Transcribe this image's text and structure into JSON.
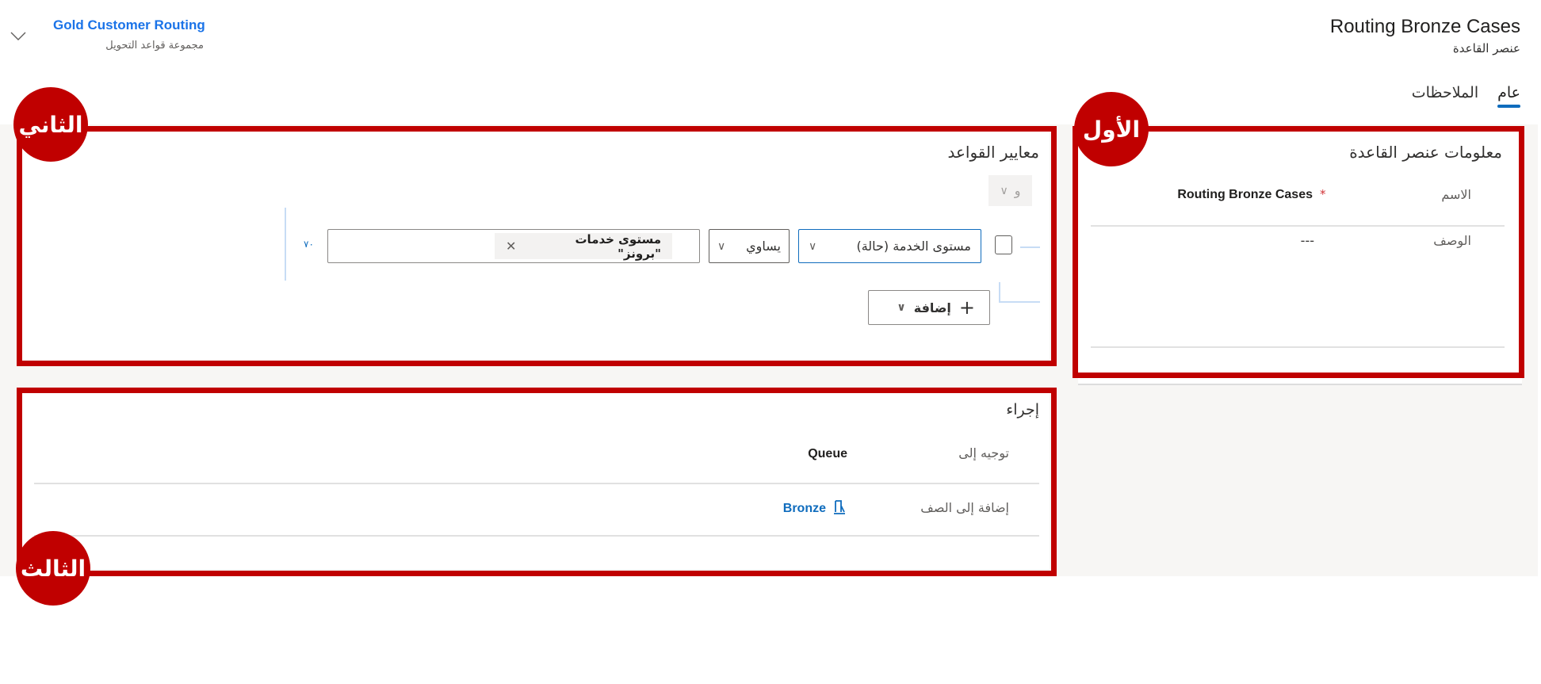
{
  "header": {
    "title": "Routing Bronze Cases",
    "subtitle": "عنصر القاعدة",
    "ruleset_link": "Gold Customer Routing",
    "ruleset_caption": "مجموعة قواعد التحويل"
  },
  "tabs": [
    {
      "label": "عام",
      "active": true
    },
    {
      "label": "الملاحظات",
      "active": false
    }
  ],
  "callouts": {
    "first": "الأول",
    "second": "الثاني",
    "third": "الثالث"
  },
  "rule_info": {
    "section_title": "معلومات عنصر القاعدة",
    "name_label": "الاسم",
    "name_value": "Routing Bronze Cases",
    "required_mark": "*",
    "description_label": "الوصف",
    "description_value": "---"
  },
  "criteria": {
    "section_title": "معايير القواعد",
    "group_operator": "و",
    "row": {
      "field": "مستوى الخدمة (حالة)",
      "operator": "يساوي",
      "value_tag": "مستوى خدمات \"برونز\"",
      "side_value": "٧٠"
    },
    "add_label": "إضافة"
  },
  "action": {
    "section_title": "إجراء",
    "rows": [
      {
        "label": "توجيه إلى",
        "value": "Queue"
      },
      {
        "label": "إضافة إلى الصف",
        "value": "Bronze"
      }
    ]
  },
  "colors": {
    "accent": "#0f6cbd",
    "callout": "#c00000",
    "link": "#1a73e8"
  }
}
